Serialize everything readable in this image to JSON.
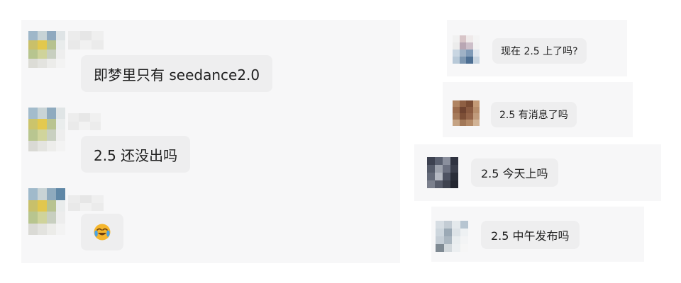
{
  "left_chat": {
    "messages": [
      {
        "text": "即梦里只有 seedance2.0"
      },
      {
        "text": "2.5 还没出吗"
      },
      {
        "text": "",
        "emoji": "crying-laughing-emoji"
      }
    ]
  },
  "right_chats": [
    {
      "text": "现在 2.5 上了吗?"
    },
    {
      "text": "2.5 有消息了吗"
    },
    {
      "text": "2.5 今天上吗"
    },
    {
      "text": "2.5 中午发布吗"
    }
  ],
  "colors": {
    "panel_bg": "#f7f7f8",
    "bubble_bg": "#eeeeef",
    "emoji_yellow": "#f5b62d",
    "emoji_tear": "#4aa3e6"
  }
}
